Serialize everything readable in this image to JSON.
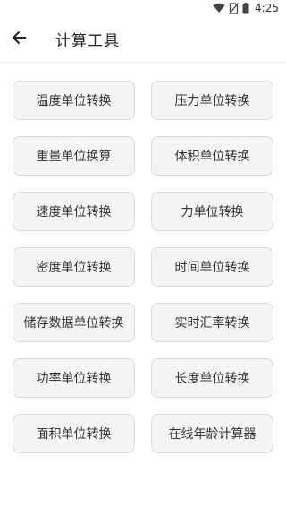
{
  "status_bar": {
    "time": "4:25",
    "icons": [
      "wifi-icon",
      "no-sim-icon",
      "battery-icon"
    ]
  },
  "header": {
    "back_icon": "arrow-left-icon",
    "title": "计算工具"
  },
  "tools": [
    {
      "label": "温度单位转换"
    },
    {
      "label": "压力单位转换"
    },
    {
      "label": "重量单位换算"
    },
    {
      "label": "体积单位转换"
    },
    {
      "label": "速度单位转换"
    },
    {
      "label": "力单位转换"
    },
    {
      "label": "密度单位转换"
    },
    {
      "label": "时间单位转换"
    },
    {
      "label": "储存数据单位转换"
    },
    {
      "label": "实时汇率转换"
    },
    {
      "label": "功率单位转换"
    },
    {
      "label": "长度单位转换"
    },
    {
      "label": "面积单位转换"
    },
    {
      "label": "在线年龄计算器"
    }
  ],
  "colors": {
    "button_bg": "#f5f5f5",
    "button_border": "#d9d9d9",
    "text": "#333333"
  }
}
